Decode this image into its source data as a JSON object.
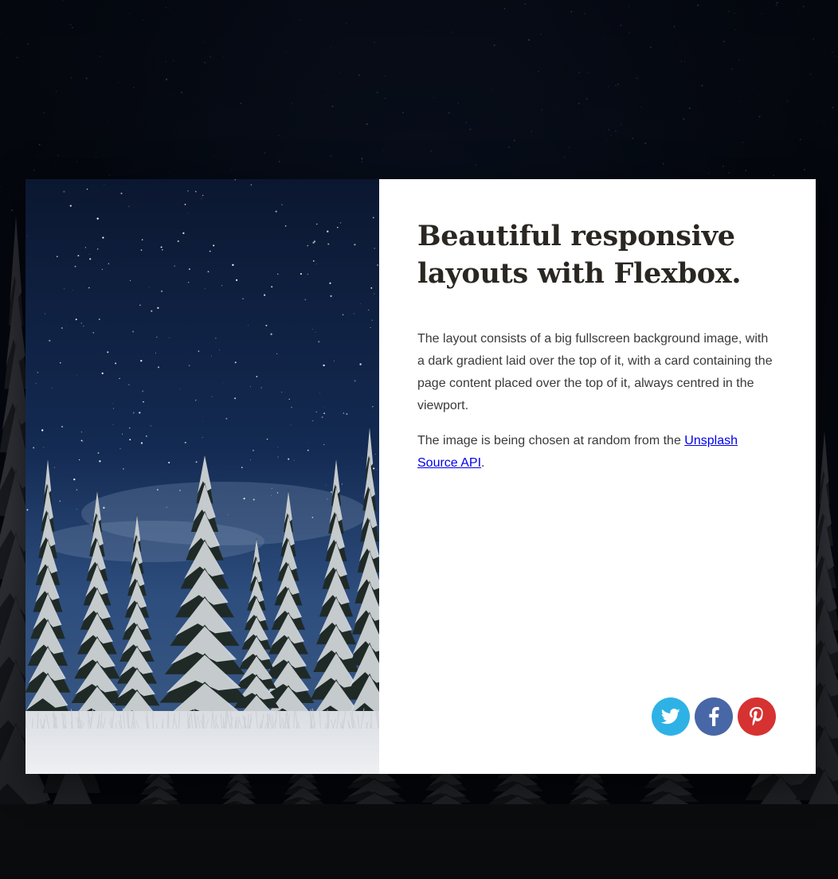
{
  "card": {
    "title": "Beautiful responsive layouts with Flexbox.",
    "paragraph_1": "The layout consists of a big fullscreen background image, with a dark gradient laid over the top of it, with a card containing the page content placed over the top of it, always centred in the viewport.",
    "paragraph_2_before": "The image is being chosen at random from the ",
    "paragraph_2_link": "Unsplash Source API",
    "paragraph_2_after": "."
  },
  "social": [
    {
      "name": "twitter",
      "icon": "twitter-icon",
      "color": "#2eb2e6"
    },
    {
      "name": "facebook",
      "icon": "facebook-icon",
      "color": "#4867a6"
    },
    {
      "name": "pinterest",
      "icon": "pinterest-icon",
      "color": "#d63232"
    }
  ],
  "colors": {
    "title": "#2a2722",
    "text": "#3a3a3a",
    "link": "#0000ee",
    "card_background": "#ffffff",
    "page_background": "#05080f"
  }
}
